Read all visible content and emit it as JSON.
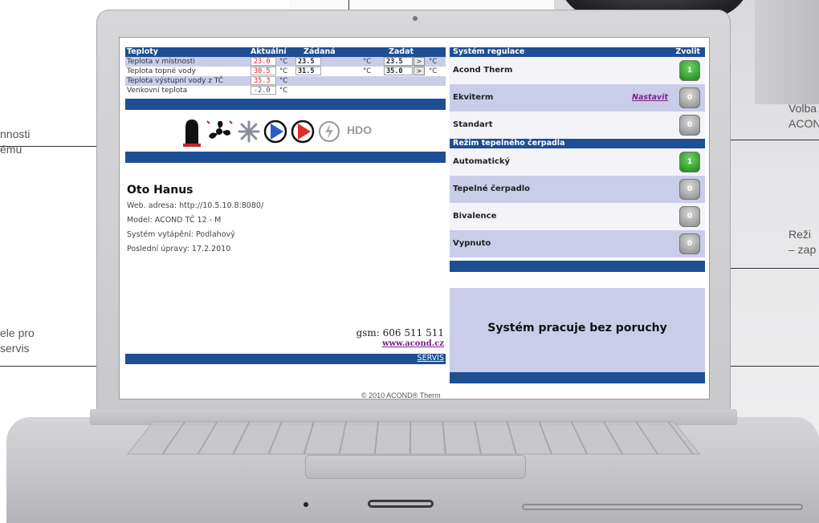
{
  "callouts": {
    "left_top": [
      "nnosti",
      "ému"
    ],
    "left_bottom": [
      "ele pro",
      "servis"
    ],
    "right_top": [
      "Volba",
      "ACON"
    ],
    "right_mid": [
      "Reži",
      "– zap"
    ]
  },
  "temps": {
    "header": {
      "title": "Teploty",
      "col_act": "Aktuální",
      "col_req": "Žádaná",
      "col_set": "Zadat"
    },
    "unit": "°C",
    "arrow": ">",
    "rows": [
      {
        "label": "Teplota v místnosti",
        "actual": "23.0",
        "required": "23.5",
        "set": "23.5"
      },
      {
        "label": "Teplota topné vody",
        "actual": "30.5",
        "required": "31.5",
        "set": "35.0"
      },
      {
        "label": "Teplota výstupní vody z TČ",
        "actual": "35.3"
      },
      {
        "label": "Venkovní teplota",
        "actual": "-2.0"
      }
    ]
  },
  "icons_row": {
    "names": [
      "boiler-icon",
      "fan-icon",
      "snowflake-icon",
      "pump-blue-icon",
      "pump-red-icon",
      "lightning-icon"
    ],
    "hdo_label": "HDO"
  },
  "owner": {
    "name": "Oto Hanus",
    "web": "Web. adresa: http://10.5.10.8:8080/",
    "model": "Model: ACOND TČ 12 - M",
    "system": "Systém vytápění: Podlahový",
    "updated": "Poslední úpravy: 17.2.2010",
    "gsm": "gsm: 606 511 511",
    "www": "www.acond.cz",
    "servis": "SERVIS"
  },
  "regulation": {
    "title": "Systém regulace",
    "choose": "Zvolit",
    "items": [
      {
        "label": "Acond Therm",
        "state": "1",
        "on": true
      },
      {
        "label": "Ekviterm",
        "link": "Nastavit",
        "state": "0",
        "on": false
      },
      {
        "label": "Standart",
        "state": "0",
        "on": false
      }
    ]
  },
  "mode": {
    "title": "Režim tepelného čerpadla",
    "items": [
      {
        "label": "Automatický",
        "state": "1",
        "on": true
      },
      {
        "label": "Tepelné čerpadlo",
        "state": "0",
        "on": false
      },
      {
        "label": "Bivalence",
        "state": "0",
        "on": false
      },
      {
        "label": "Vypnuto",
        "state": "0",
        "on": false
      }
    ]
  },
  "status_text": "Systém pracuje bez poruchy",
  "copyright": "© 2010 ACOND® Therm",
  "colors": {
    "header_blue": "#1e4e94",
    "row_purple": "#c9cde8",
    "toggle_on": "#2f9c2a",
    "toggle_off": "#9e9e9e",
    "actual_red": "#e0202a",
    "link_purple": "#7a1f8a"
  }
}
